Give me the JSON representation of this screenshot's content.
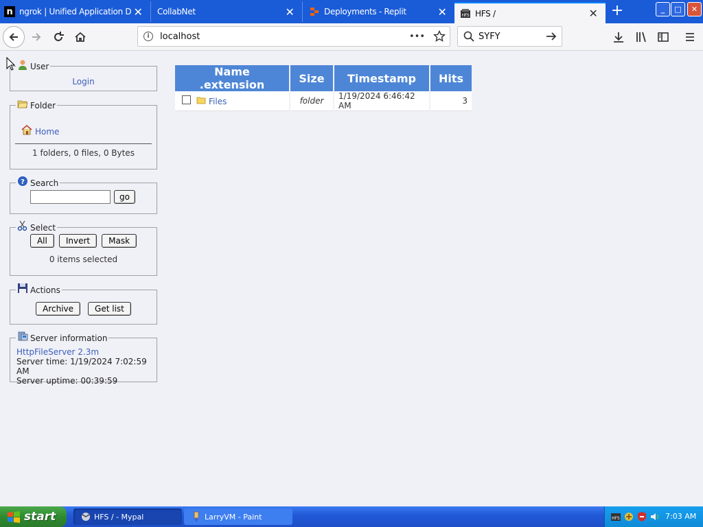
{
  "browser": {
    "tabs": [
      {
        "title": "ngrok | Unified Application Delivery",
        "favicon": "ngrok-icon"
      },
      {
        "title": "CollabNet",
        "favicon": "none"
      },
      {
        "title": "Deployments - Replit",
        "favicon": "replit-icon"
      },
      {
        "title": "HFS /",
        "favicon": "hfs-icon",
        "active": true
      }
    ],
    "new_tab": "+",
    "url": "localhost",
    "search_value": "SYFY",
    "page_actions": "•••",
    "window_controls": {
      "minimize": "_",
      "maximize": "□",
      "close": "✕"
    }
  },
  "sidebar": {
    "user": {
      "legend": "User",
      "login": "Login"
    },
    "folder": {
      "legend": "Folder",
      "home": "Home",
      "summary": "1 folders, 0 files, 0 Bytes"
    },
    "search": {
      "legend": "Search",
      "input_value": "",
      "go": "go"
    },
    "select": {
      "legend": "Select",
      "all": "All",
      "invert": "Invert",
      "mask": "Mask",
      "status": "0 items selected"
    },
    "actions": {
      "legend": "Actions",
      "archive": "Archive",
      "get_list": "Get list"
    },
    "server": {
      "legend": "Server information",
      "software": "HttpFileServer 2.3m",
      "time": "Server time: 1/19/2024 7:02:59 AM",
      "uptime": "Server uptime: 00:39:59"
    }
  },
  "table": {
    "columns": [
      "Name .extension",
      "Size",
      "Timestamp",
      "Hits"
    ],
    "rows": [
      {
        "name": "Files",
        "size": "folder",
        "timestamp": "1/19/2024 6:46:42 AM",
        "hits": "3"
      }
    ]
  },
  "taskbar": {
    "start": "start",
    "items": [
      {
        "label": "HFS / - Mypal",
        "active": true
      },
      {
        "label": "LarryVM - Paint",
        "active": false
      }
    ],
    "clock": "7:03 AM"
  }
}
